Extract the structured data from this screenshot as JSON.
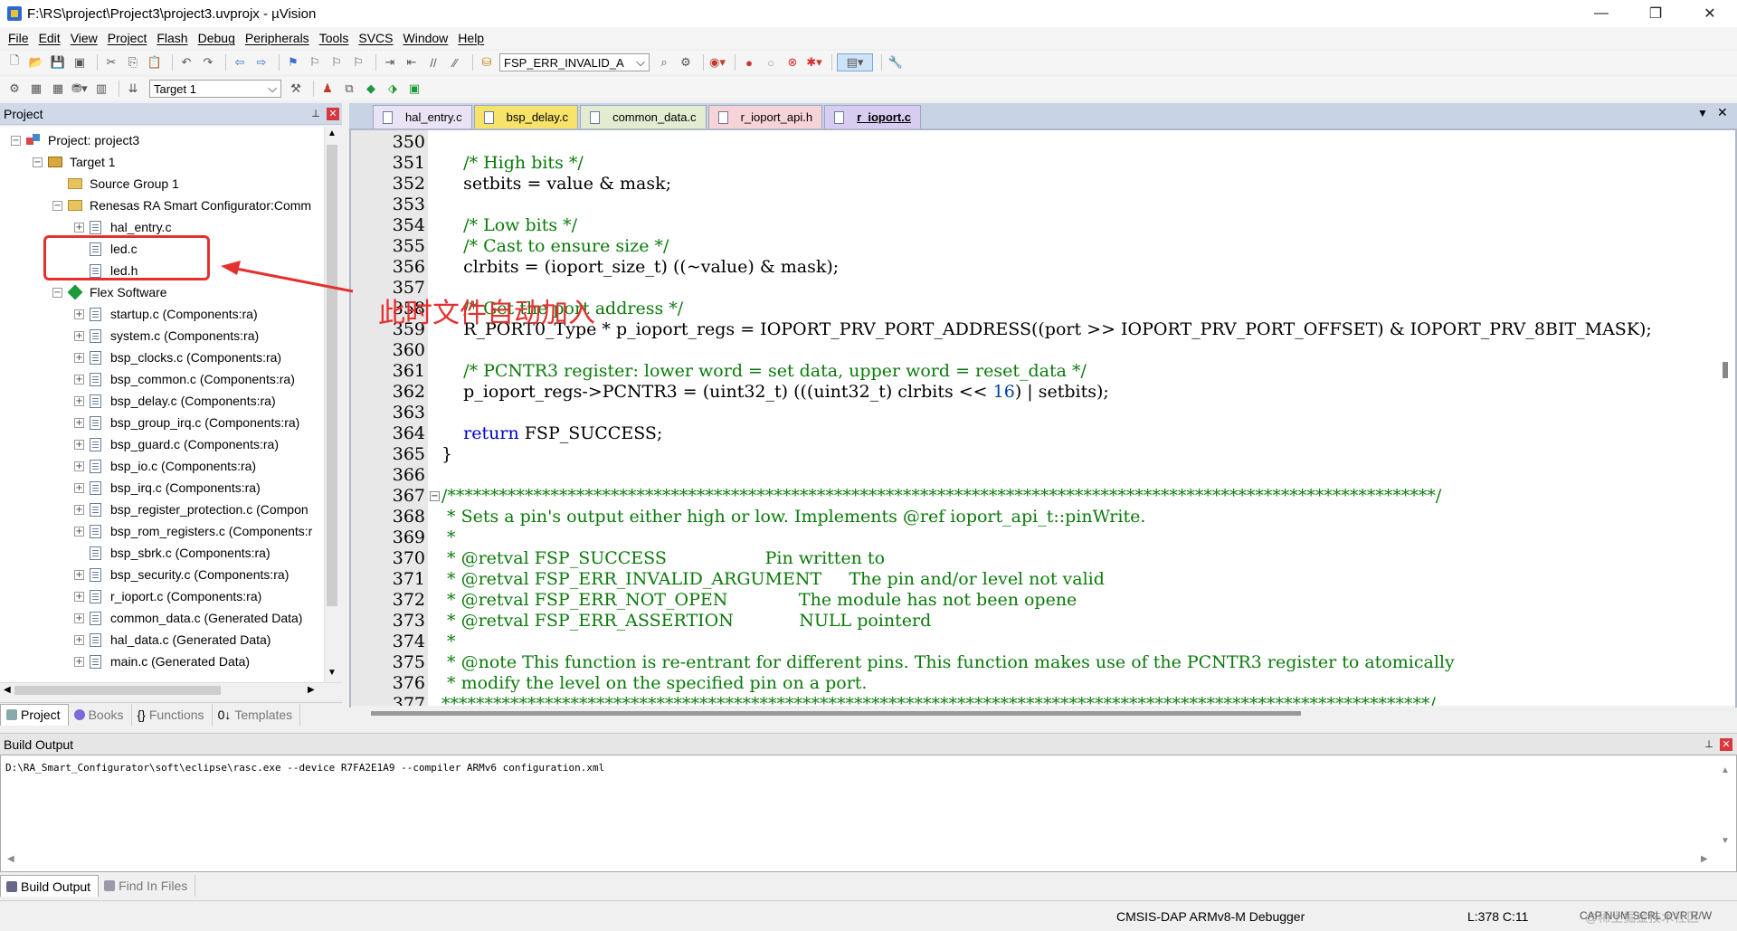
{
  "window": {
    "title": "F:\\RS\\project\\Project3\\project3.uvprojx - µVision",
    "buttons": [
      "—",
      "❐",
      "✕"
    ]
  },
  "menu": [
    "File",
    "Edit",
    "View",
    "Project",
    "Flash",
    "Debug",
    "Peripherals",
    "Tools",
    "SVCS",
    "Window",
    "Help"
  ],
  "toolbar": {
    "find_combo": "FSP_ERR_INVALID_A",
    "target_combo": "Target 1"
  },
  "project_panel": {
    "title": "Project",
    "tree": [
      {
        "label": "Project: project3",
        "icon": "project-icon",
        "level": 0,
        "expander": "⊟"
      },
      {
        "label": "Target 1",
        "icon": "target-icon",
        "level": 1,
        "expander": "⊟"
      },
      {
        "label": "Source Group 1",
        "icon": "folder-icon",
        "level": 2,
        "expander": ""
      },
      {
        "label": "Renesas RA Smart Configurator:Comm",
        "icon": "folder-icon",
        "level": 2,
        "expander": "⊟"
      },
      {
        "label": "hal_entry.c",
        "icon": "file-icon",
        "level": 3,
        "expander": "⊞"
      },
      {
        "label": "led.c",
        "icon": "file-icon",
        "level": 3,
        "expander": ""
      },
      {
        "label": "led.h",
        "icon": "file-icon",
        "level": 3,
        "expander": ""
      },
      {
        "label": "Flex Software",
        "icon": "diamond-icon",
        "level": 2,
        "expander": "⊟"
      },
      {
        "label": "startup.c (Components:ra)",
        "icon": "file-icon",
        "level": 3,
        "expander": "⊞"
      },
      {
        "label": "system.c (Components:ra)",
        "icon": "file-icon",
        "level": 3,
        "expander": "⊞"
      },
      {
        "label": "bsp_clocks.c (Components:ra)",
        "icon": "file-icon",
        "level": 3,
        "expander": "⊞"
      },
      {
        "label": "bsp_common.c (Components:ra)",
        "icon": "file-icon",
        "level": 3,
        "expander": "⊞"
      },
      {
        "label": "bsp_delay.c (Components:ra)",
        "icon": "file-icon",
        "level": 3,
        "expander": "⊞"
      },
      {
        "label": "bsp_group_irq.c (Components:ra)",
        "icon": "file-icon",
        "level": 3,
        "expander": "⊞"
      },
      {
        "label": "bsp_guard.c (Components:ra)",
        "icon": "file-icon",
        "level": 3,
        "expander": "⊞"
      },
      {
        "label": "bsp_io.c (Components:ra)",
        "icon": "file-icon",
        "level": 3,
        "expander": "⊞"
      },
      {
        "label": "bsp_irq.c (Components:ra)",
        "icon": "file-icon",
        "level": 3,
        "expander": "⊞"
      },
      {
        "label": "bsp_register_protection.c (Compon",
        "icon": "file-icon",
        "level": 3,
        "expander": "⊞"
      },
      {
        "label": "bsp_rom_registers.c (Components:r",
        "icon": "file-icon",
        "level": 3,
        "expander": "⊞"
      },
      {
        "label": "bsp_sbrk.c (Components:ra)",
        "icon": "file-icon",
        "level": 3,
        "expander": ""
      },
      {
        "label": "bsp_security.c (Components:ra)",
        "icon": "file-icon",
        "level": 3,
        "expander": "⊞"
      },
      {
        "label": "r_ioport.c (Components:ra)",
        "icon": "file-icon",
        "level": 3,
        "expander": "⊞"
      },
      {
        "label": "common_data.c (Generated Data)",
        "icon": "file-icon",
        "level": 3,
        "expander": "⊞"
      },
      {
        "label": "hal_data.c (Generated Data)",
        "icon": "file-icon",
        "level": 3,
        "expander": "⊞"
      },
      {
        "label": "main.c (Generated Data)",
        "icon": "file-icon",
        "level": 3,
        "expander": "⊞"
      }
    ],
    "tabs": [
      "Project",
      "Books",
      "Functions",
      "Templates"
    ]
  },
  "editor": {
    "tabs": [
      {
        "label": "hal_entry.c",
        "color": "#e9e3f5"
      },
      {
        "label": "bsp_delay.c",
        "color": "#f7e36a"
      },
      {
        "label": "common_data.c",
        "color": "#e3ecd0"
      },
      {
        "label": "r_ioport_api.h",
        "color": "#f6d3d6"
      },
      {
        "label": "r_ioport.c",
        "color": "#d8cdf0"
      }
    ],
    "lines": [
      {
        "n": "350",
        "html": ""
      },
      {
        "n": "351",
        "html": "    <span class='cm'>/* High bits */</span>"
      },
      {
        "n": "352",
        "html": "    setbits = value &amp; mask;"
      },
      {
        "n": "353",
        "html": ""
      },
      {
        "n": "354",
        "html": "    <span class='cm'>/* Low bits */</span>"
      },
      {
        "n": "355",
        "html": "    <span class='cm'>/* Cast to ensure size */</span>"
      },
      {
        "n": "356",
        "html": "    clrbits = (ioport_size_t) ((~value) &amp; mask);"
      },
      {
        "n": "357",
        "html": ""
      },
      {
        "n": "358",
        "html": "    <span class='cm'>/* Get the port address */</span>"
      },
      {
        "n": "359",
        "html": "    R_PORT0_Type * p_ioport_regs = IOPORT_PRV_PORT_ADDRESS((port &gt;&gt; IOPORT_PRV_PORT_OFFSET) &amp; IOPORT_PRV_8BIT_MASK);"
      },
      {
        "n": "360",
        "html": ""
      },
      {
        "n": "361",
        "html": "    <span class='cm'>/* PCNTR3 register: lower word = set data, upper word = reset_data */</span>"
      },
      {
        "n": "362",
        "html": "    p_ioport_regs-&gt;PCNTR3 = (uint32_t) (((uint32_t) clrbits &lt;&lt; <span class='nm'>16</span>) | setbits);"
      },
      {
        "n": "363",
        "html": ""
      },
      {
        "n": "364",
        "html": "    <span class='kw'>return</span> FSP_SUCCESS;"
      },
      {
        "n": "365",
        "html": "}"
      },
      {
        "n": "366",
        "html": ""
      },
      {
        "n": "367",
        "html": "<span class='banner'>/*******************************************************************************************************************/</span>"
      },
      {
        "n": "368",
        "html": "<span class='cm'> * Sets a pin's output either high or low. Implements @ref ioport_api_t::pinWrite.</span>"
      },
      {
        "n": "369",
        "html": "<span class='cm'> *</span>"
      },
      {
        "n": "370",
        "html": "<span class='cm'> * @retval FSP_SUCCESS                  Pin written to</span>"
      },
      {
        "n": "371",
        "html": "<span class='cm'> * @retval FSP_ERR_INVALID_ARGUMENT     The pin and/or level not valid</span>"
      },
      {
        "n": "372",
        "html": "<span class='cm'> * @retval FSP_ERR_NOT_OPEN             The module has not been opene</span>"
      },
      {
        "n": "373",
        "html": "<span class='cm'> * @retval FSP_ERR_ASSERTION            NULL pointerd</span>"
      },
      {
        "n": "374",
        "html": "<span class='cm'> *</span>"
      },
      {
        "n": "375",
        "html": "<span class='cm'> * @note This function is re-entrant for different pins. This function makes use of the PCNTR3 register to atomically</span>"
      },
      {
        "n": "376",
        "html": "<span class='cm'> * modify the level on the specified pin on a port.</span>"
      },
      {
        "n": "377",
        "html": "<span class='banner'>*******************************************************************************************************************/</span>"
      }
    ]
  },
  "build_output": {
    "title": "Build Output",
    "text": "D:\\RA_Smart_Configurator\\soft\\eclipse\\rasc.exe --device R7FA2E1A9 --compiler ARMv6 configuration.xml",
    "tabs": [
      "Build Output",
      "Find In Files"
    ]
  },
  "status": {
    "debugger": "CMSIS-DAP ARMv8-M Debugger",
    "position": "L:378 C:11",
    "flags": "CAP NUM SCRL OVR R/W",
    "watermark": "@稀土掘金技术社区"
  },
  "annotation": {
    "text": "此时文件自动加入",
    "color": "#e53030"
  }
}
